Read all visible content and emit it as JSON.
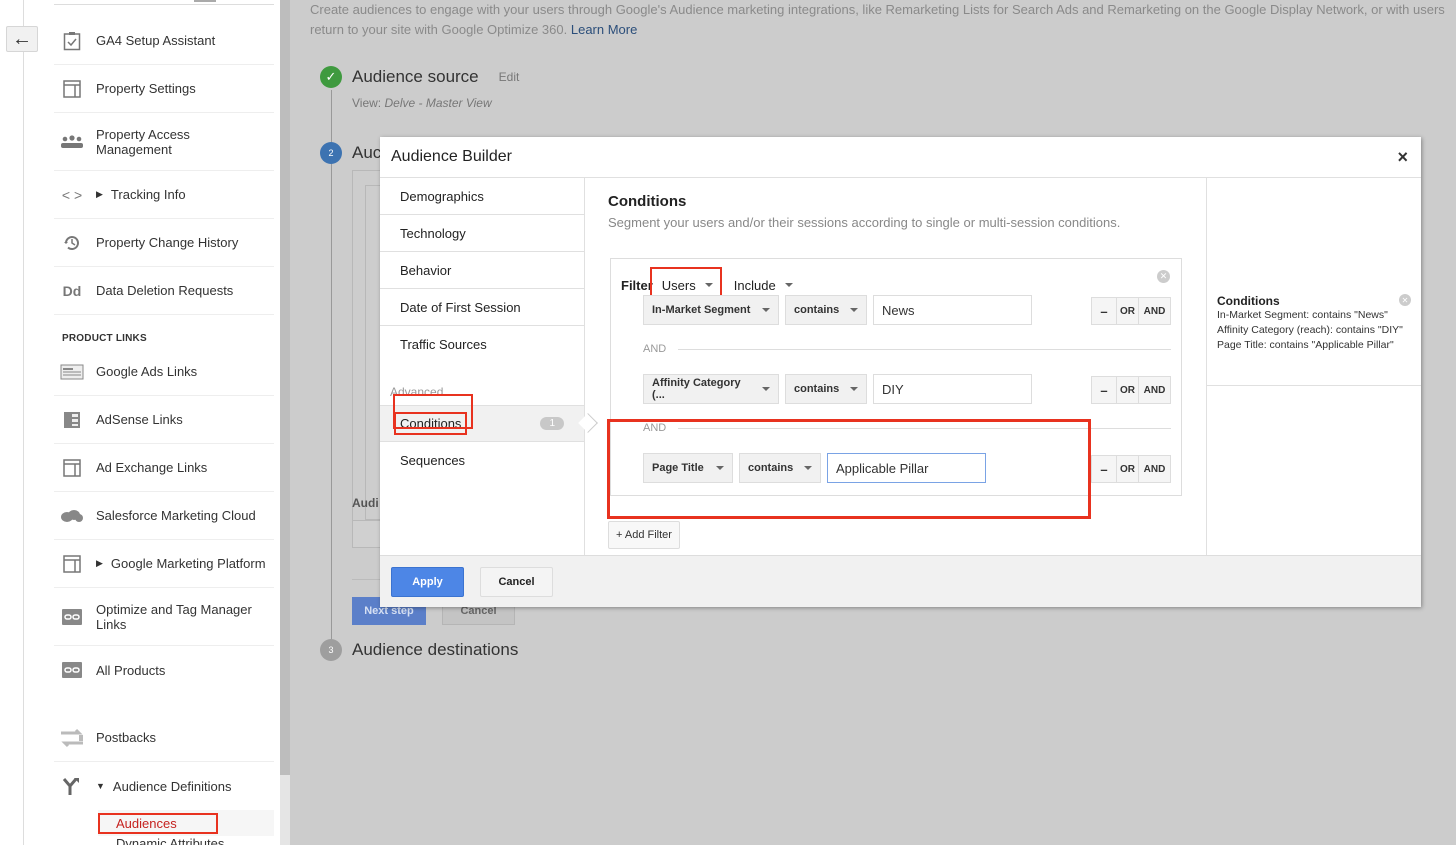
{
  "back_button": {
    "icon": "arrow-left-icon",
    "glyph": "←"
  },
  "sidebar": {
    "items": [
      {
        "icon": "clipboard-check-icon",
        "label": "GA4 Setup Assistant"
      },
      {
        "icon": "property-settings-icon",
        "label": "Property Settings"
      },
      {
        "icon": "people-icon",
        "label": "Property Access Management"
      },
      {
        "icon": "code-icon",
        "label": "Tracking Info",
        "expandable": true
      },
      {
        "icon": "history-icon",
        "label": "Property Change History"
      },
      {
        "icon": "dd-icon",
        "label": "Data Deletion Requests"
      }
    ],
    "section_label": "PRODUCT LINKS",
    "product_links": [
      {
        "icon": "google-ads-icon",
        "label": "Google Ads Links"
      },
      {
        "icon": "adsense-icon",
        "label": "AdSense Links"
      },
      {
        "icon": "ad-exchange-icon",
        "label": "Ad Exchange Links"
      },
      {
        "icon": "cloud-icon",
        "label": "Salesforce Marketing Cloud"
      },
      {
        "icon": "marketing-platform-icon",
        "label": "Google Marketing Platform",
        "expandable": true
      },
      {
        "icon": "link-icon",
        "label": "Optimize and Tag Manager Links"
      },
      {
        "icon": "link-icon",
        "label": "All Products"
      }
    ],
    "other_items": [
      {
        "icon": "postbacks-icon",
        "label": "Postbacks"
      },
      {
        "icon": "fork-icon",
        "label": "Audience Definitions",
        "expanded": true
      }
    ],
    "sub_items": [
      {
        "label": "Audiences",
        "active": true
      },
      {
        "label": "Dynamic Attributes"
      }
    ]
  },
  "main": {
    "intro_text": "Create audiences to engage with your users through Google's Audience marketing integrations, like Remarketing Lists for Search Ads and Remarketing on the Google Display Network, or with users return to your site with Google Optimize 360.",
    "learn_more": "Learn More",
    "steps": [
      {
        "number": "✓",
        "title": "Audience source",
        "action": "Edit",
        "color": "#3f9a3f"
      },
      {
        "number": "2",
        "title": "Audience definition",
        "visible_title": "Auc",
        "color": "#3d73b1"
      },
      {
        "number": "3",
        "title": "Audience destinations",
        "color": "#9e9e9e"
      }
    ],
    "view_label": "View:",
    "view_value": "Delve - Master View",
    "hidden_label": "Audi",
    "next_step": "Next step",
    "cancel": "Cancel"
  },
  "modal": {
    "title": "Audience Builder",
    "close_icon": "×",
    "nav": [
      "Demographics",
      "Technology",
      "Behavior",
      "Date of First Session",
      "Traffic Sources"
    ],
    "advanced_label": "Advanced",
    "nav_advanced": [
      {
        "label": "Conditions",
        "badge": "1",
        "active": true
      },
      {
        "label": "Sequences"
      }
    ],
    "conditions": {
      "title": "Conditions",
      "subtitle": "Segment your users and/or their sessions according to single or multi-session conditions.",
      "filter_label": "Filter",
      "scope": "Users",
      "mode": "Include",
      "and_label": "AND",
      "rows": [
        {
          "dimension": "In-Market Segment",
          "operator": "contains",
          "value": "News"
        },
        {
          "dimension": "Affinity Category (...",
          "operator": "contains",
          "value": "DIY"
        },
        {
          "dimension": "Page Title",
          "operator": "contains",
          "value": "Applicable Pillar"
        }
      ],
      "row_buttons": {
        "remove": "–",
        "or": "OR",
        "and": "AND"
      },
      "add_filter": "+ Add Filter"
    },
    "summary": {
      "title": "Conditions",
      "lines": [
        "In-Market Segment: contains \"News\"",
        "Affinity Category (reach): contains \"DIY\"",
        "Page Title: contains \"Applicable Pillar\""
      ]
    },
    "apply": "Apply",
    "cancel": "Cancel"
  },
  "colors": {
    "accent_blue": "#4d86e6",
    "highlight_red": "#e8321f",
    "overlay_gray": "#cccccc"
  }
}
